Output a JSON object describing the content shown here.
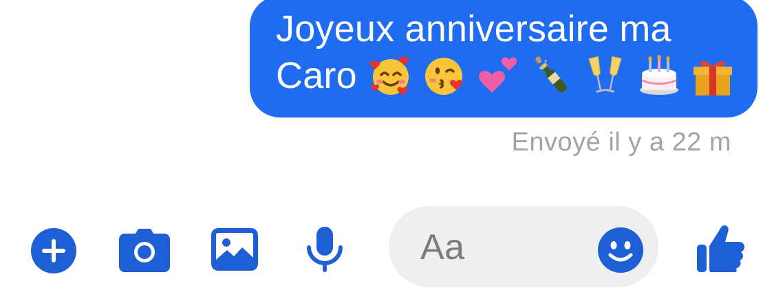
{
  "message": {
    "line1": "Joyeux anniversaire ma",
    "line2": "Caro",
    "emojis": [
      "smiling-face-with-hearts",
      "face-blowing-kiss",
      "two-hearts",
      "bottle-with-popping-cork",
      "clinking-glasses",
      "birthday-cake",
      "wrapped-gift"
    ],
    "bubble_color": "#1f6cf0"
  },
  "status": {
    "text": "Envoyé il y a 22 m"
  },
  "composer": {
    "placeholder": "Aa",
    "icons": [
      "plus-icon",
      "camera-icon",
      "gallery-icon",
      "microphone-icon",
      "emoji-smiley-icon",
      "thumbs-up-icon"
    ],
    "accent_color": "#1f5fd6"
  }
}
